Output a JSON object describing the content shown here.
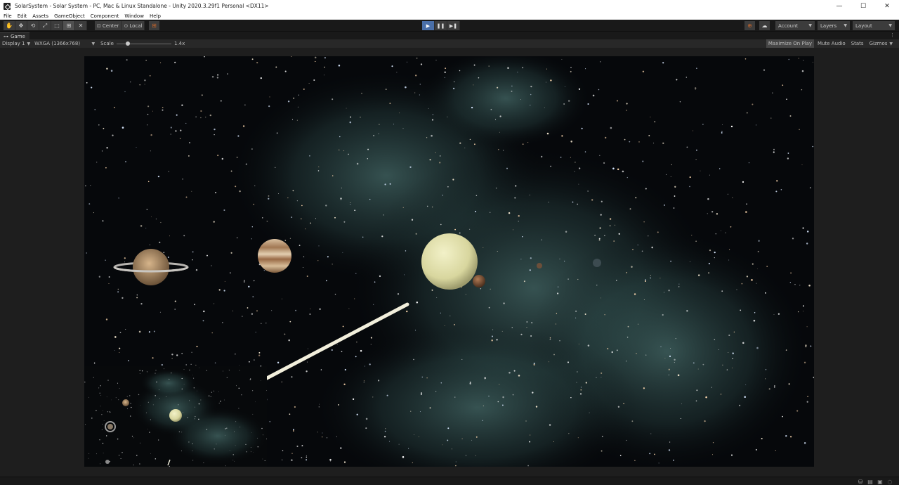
{
  "window": {
    "title": "SolarSystem - Solar System - PC, Mac & Linux Standalone - Unity 2020.3.29f1 Personal <DX11>",
    "minimize_symbol": "—",
    "maximize_symbol": "☐",
    "close_symbol": "✕"
  },
  "menu": {
    "items": [
      "File",
      "Edit",
      "Assets",
      "GameObject",
      "Component",
      "Window",
      "Help"
    ]
  },
  "toolbar": {
    "tools": [
      {
        "icon": "hand-tool-icon",
        "glyph": "✋"
      },
      {
        "icon": "move-tool-icon",
        "glyph": "✥"
      },
      {
        "icon": "rotate-tool-icon",
        "glyph": "⟲"
      },
      {
        "icon": "scale-tool-icon",
        "glyph": "⤢"
      },
      {
        "icon": "rect-tool-icon",
        "glyph": "⬚"
      },
      {
        "icon": "transform-tool-icon",
        "glyph": "⊞"
      },
      {
        "icon": "custom-tool-icon",
        "glyph": "✕"
      }
    ],
    "active_tool_index": 5,
    "pivot_label": "Center",
    "rotation_label": "Local",
    "account_label": "Account",
    "layers_label": "Layers",
    "layout_label": "Layout"
  },
  "playback": {
    "play_glyph": "▶",
    "pause_glyph": "❚❚",
    "step_glyph": "▶❚",
    "playing": true
  },
  "game_tab": {
    "label": "Game",
    "menu_glyph": "⋮"
  },
  "game_toolbar": {
    "display": "Display 1",
    "resolution": "WXGA (1366x768)",
    "scale_label": "Scale",
    "scale_value": "1.4x",
    "scale_level": 0.2,
    "maximize_on_play": "Maximize On Play",
    "mute_audio": "Mute Audio",
    "stats": "Stats",
    "gizmos": "Gizmos"
  },
  "colors": {
    "play_active": "#4a6fa8",
    "accent_orange": "#c0642c",
    "nebula": "#4f7d7a",
    "sun": "#e4e3ad"
  }
}
